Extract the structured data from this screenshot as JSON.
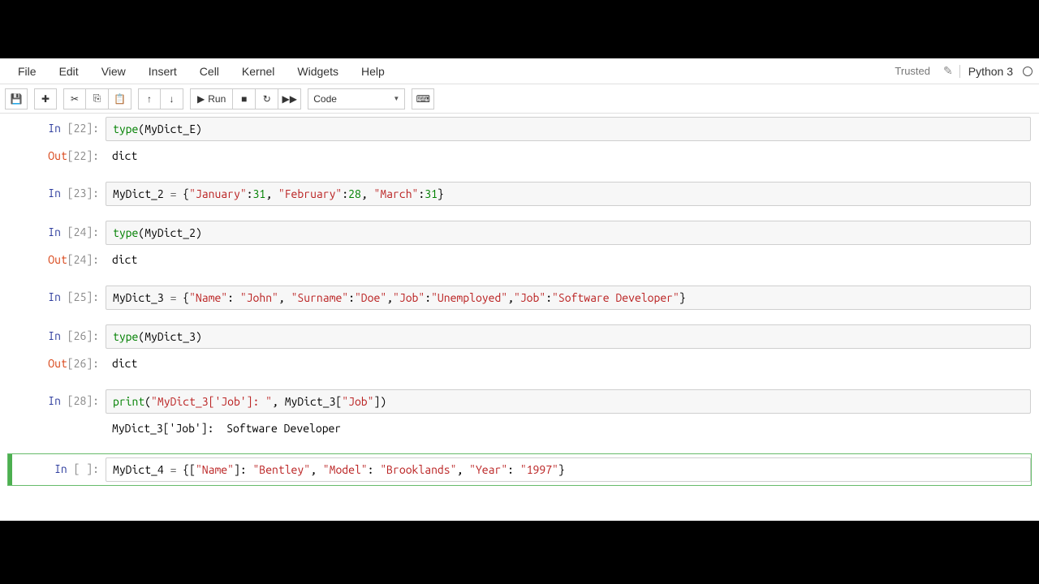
{
  "menu": {
    "file": "File",
    "edit": "Edit",
    "view": "View",
    "insert": "Insert",
    "cell": "Cell",
    "kernel": "Kernel",
    "widgets": "Widgets",
    "help": "Help"
  },
  "header": {
    "trusted": "Trusted",
    "kernel": "Python 3"
  },
  "toolbar": {
    "run": "Run",
    "celltype": "Code"
  },
  "cells": [
    {
      "in_prompt": "In [22]:",
      "code_html": "<span class='tok-b'>type</span>(MyDict_E)"
    },
    {
      "out_prompt": "Out[22]:",
      "output": "dict"
    },
    {
      "in_prompt": "In [23]:",
      "code_html": "MyDict_2 <span class='tok-o'>=</span> {<span class='tok-s'>\"January\"</span>:<span class='tok-num'>31</span>, <span class='tok-s'>\"February\"</span>:<span class='tok-num'>28</span>, <span class='tok-s'>\"March\"</span>:<span class='tok-num'>31</span>}"
    },
    {
      "in_prompt": "In [24]:",
      "code_html": "<span class='tok-b'>type</span>(MyDict_2)"
    },
    {
      "out_prompt": "Out[24]:",
      "output": "dict"
    },
    {
      "in_prompt": "In [25]:",
      "code_html": "MyDict_3 <span class='tok-o'>=</span> {<span class='tok-s'>\"Name\"</span>: <span class='tok-s'>\"John\"</span>, <span class='tok-s'>\"Surname\"</span>:<span class='tok-s'>\"Doe\"</span>,<span class='tok-s'>\"Job\"</span>:<span class='tok-s'>\"Unemployed\"</span>,<span class='tok-s'>\"Job\"</span>:<span class='tok-s'>\"Software Developer\"</span>}"
    },
    {
      "in_prompt": "In [26]:",
      "code_html": "<span class='tok-b'>type</span>(MyDict_3)"
    },
    {
      "out_prompt": "Out[26]:",
      "output": "dict"
    },
    {
      "in_prompt": "In [28]:",
      "code_html": "<span class='tok-b'>print</span>(<span class='tok-s'>\"MyDict_3['Job']: \"</span>, MyDict_3[<span class='tok-s'>\"Job\"</span>])"
    },
    {
      "out_prompt": "",
      "output": "MyDict_3['Job']:  Software Developer"
    },
    {
      "in_prompt": "In [ ]:",
      "code_html": "MyDict_4 <span class='tok-o'>=</span> {[<span class='tok-s'>\"Name\"</span>]: <span class='tok-s'>\"Bentley\"</span>, <span class='tok-s'>\"Model\"</span>: <span class='tok-s'>\"Brooklands\"</span>, <span class='tok-s'>\"Year\"</span>: <span class='tok-s'>\"1997\"</span>}",
      "selected": true
    }
  ]
}
